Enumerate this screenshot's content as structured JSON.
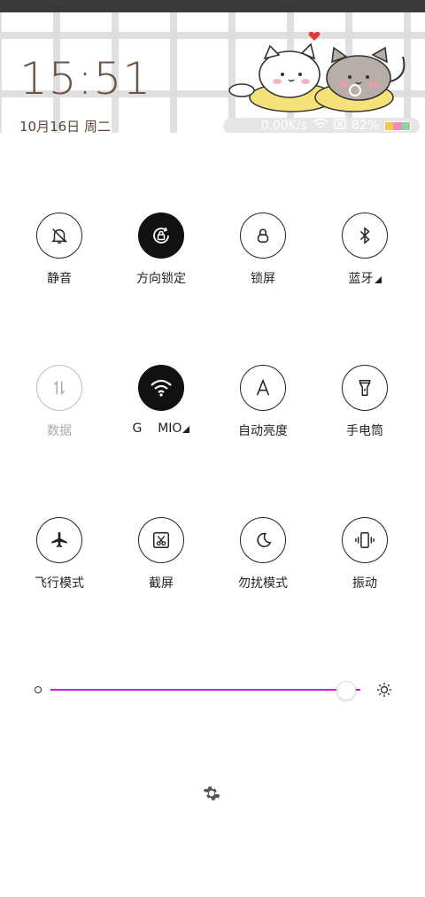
{
  "header": {
    "time": "15:51",
    "date": "10月16日 周二"
  },
  "status": {
    "net_speed": "0.00K/s",
    "battery_percent": "82%",
    "battery_colors": [
      "#f2c94c",
      "#f28bb0",
      "#8fd19e"
    ]
  },
  "tiles": [
    {
      "label": "静音",
      "icon": "bell-off-icon",
      "state": "off"
    },
    {
      "label": "方向锁定",
      "icon": "rotation-lock-icon",
      "state": "on"
    },
    {
      "label": "锁屏",
      "icon": "lock-icon",
      "state": "off"
    },
    {
      "label": "蓝牙",
      "icon": "bluetooth-icon",
      "state": "off",
      "expandable": true
    },
    {
      "label": "数据",
      "icon": "mobile-data-icon",
      "state": "disabled"
    },
    {
      "label": "G    MIO",
      "icon": "wifi-icon",
      "state": "on",
      "expandable": true
    },
    {
      "label": "自动亮度",
      "icon": "auto-brightness-icon",
      "state": "off"
    },
    {
      "label": "手电筒",
      "icon": "flashlight-icon",
      "state": "off"
    },
    {
      "label": "飞行模式",
      "icon": "airplane-icon",
      "state": "off"
    },
    {
      "label": "截屏",
      "icon": "screenshot-icon",
      "state": "off"
    },
    {
      "label": "勿扰模式",
      "icon": "moon-icon",
      "state": "off"
    },
    {
      "label": "振动",
      "icon": "vibrate-icon",
      "state": "off"
    }
  ],
  "brightness": {
    "level": 0.95,
    "track_color": "#d21bd4"
  },
  "footer": {
    "icon": "settings-gear-icon"
  }
}
